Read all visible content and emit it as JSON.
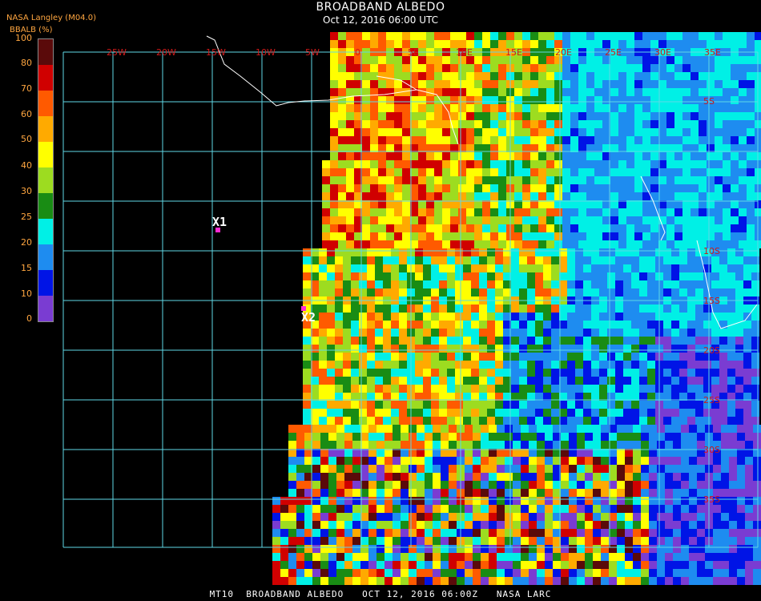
{
  "header": {
    "title": "BROADBAND ALBEDO",
    "subtitle": "Oct 12, 2016 06:00 UTC",
    "source": "NASA Langley (M04.0)",
    "unit_label": "BBALB (%)"
  },
  "legend": {
    "labels": [
      "100",
      "80",
      "70",
      "60",
      "50",
      "40",
      "30",
      "25",
      "20",
      "15",
      "10",
      "0"
    ],
    "colors": [
      "#5a0a0a",
      "#d00000",
      "#ff5a00",
      "#ffaa00",
      "#ffff00",
      "#9ddc20",
      "#198c14",
      "#00f0e6",
      "#1e8cf0",
      "#0014e6",
      "#7a3cd2"
    ]
  },
  "map": {
    "lon_labels": [
      "25W",
      "20W",
      "15W",
      "10W",
      "5W",
      "0",
      "5E",
      "10E",
      "15E",
      "20E",
      "25E",
      "30E",
      "35E"
    ],
    "lat_labels": [
      "5S",
      "10S",
      "15S",
      "20S",
      "25S",
      "30S",
      "35S"
    ],
    "markers": [
      {
        "label": "X1"
      },
      {
        "label": "X2"
      }
    ]
  },
  "footer": "MT10  BROADBAND ALBEDO   OCT 12, 2016 06:00Z   NASA LARC"
}
